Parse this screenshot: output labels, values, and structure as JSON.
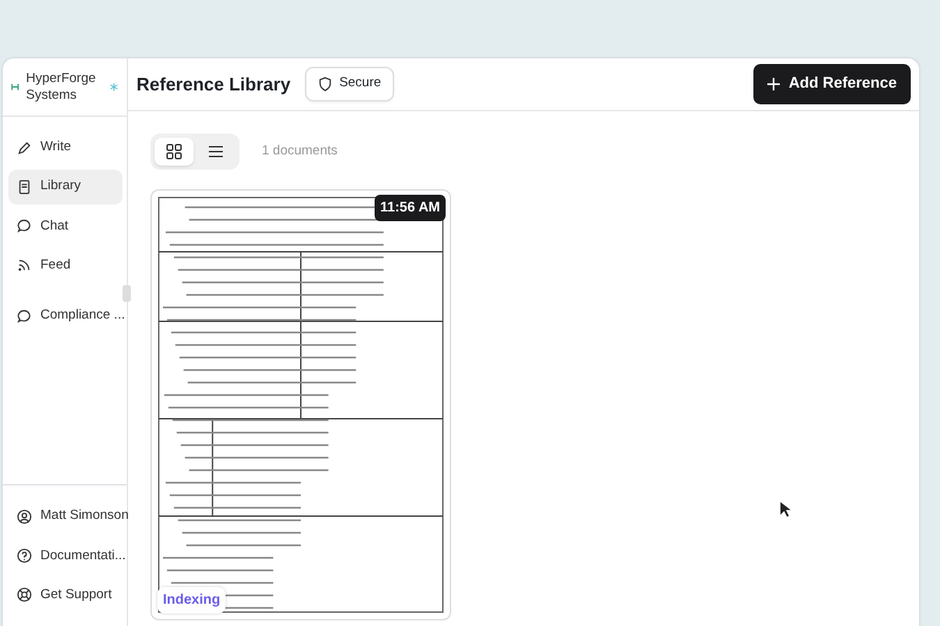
{
  "sidebar": {
    "brand": "HyperForge Systems",
    "nav": [
      {
        "label": "Write",
        "selected": false
      },
      {
        "label": "Library",
        "selected": true
      },
      {
        "label": "Chat",
        "selected": false
      },
      {
        "label": "Feed",
        "selected": false
      },
      {
        "label": "Compliance ...",
        "selected": false
      }
    ],
    "footer": [
      {
        "label": "Matt Simonson"
      },
      {
        "label": "Documentati..."
      },
      {
        "label": "Get Support"
      }
    ]
  },
  "header": {
    "title": "Reference Library",
    "badge": "Secure",
    "button": "Add Reference"
  },
  "view_toggle": [
    {
      "selected": true
    },
    {
      "selected": false
    }
  ],
  "count": "1 documents",
  "documents": [
    {
      "time": "11:56 AM",
      "status": "Indexing"
    }
  ]
}
